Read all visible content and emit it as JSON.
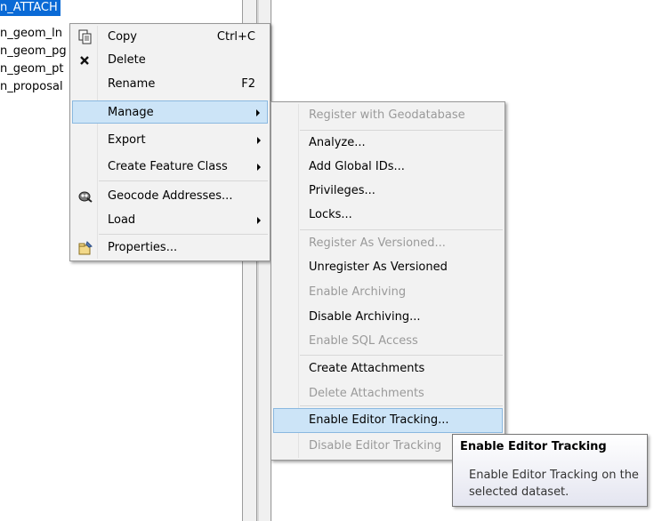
{
  "tree": {
    "items": [
      {
        "label": "n_ATTACH",
        "selected": true
      },
      {
        "label": "n_geom_ln",
        "selected": false
      },
      {
        "label": "n_geom_pg",
        "selected": false
      },
      {
        "label": "n_geom_pt",
        "selected": false
      },
      {
        "label": "n_proposal",
        "selected": false
      }
    ]
  },
  "context_menu": {
    "items": [
      {
        "label": "Copy",
        "shortcut": "Ctrl+C",
        "icon": "copy-icon"
      },
      {
        "label": "Delete",
        "icon": "delete-x-icon"
      },
      {
        "label": "Rename",
        "shortcut": "F2"
      },
      {
        "label": "Manage",
        "submenu": true,
        "highlighted": true
      },
      {
        "label": "Export",
        "submenu": true
      },
      {
        "label": "Create Feature Class",
        "submenu": true
      },
      {
        "label": "Geocode Addresses...",
        "icon": "geocode-icon"
      },
      {
        "label": "Load",
        "submenu": true
      },
      {
        "label": "Properties...",
        "icon": "properties-icon"
      }
    ]
  },
  "manage_submenu": {
    "items": [
      {
        "label": "Register with Geodatabase",
        "disabled": true
      },
      {
        "label": "Analyze...",
        "disabled": false
      },
      {
        "label": "Add Global IDs...",
        "disabled": false
      },
      {
        "label": "Privileges...",
        "disabled": false
      },
      {
        "label": "Locks...",
        "disabled": false
      },
      {
        "label": "Register As Versioned...",
        "disabled": true
      },
      {
        "label": "Unregister As Versioned",
        "disabled": false
      },
      {
        "label": "Enable Archiving",
        "disabled": true
      },
      {
        "label": "Disable Archiving...",
        "disabled": false
      },
      {
        "label": "Enable SQL Access",
        "disabled": true
      },
      {
        "label": "Create Attachments",
        "disabled": false
      },
      {
        "label": "Delete Attachments",
        "disabled": true
      },
      {
        "label": "Enable Editor Tracking...",
        "disabled": false,
        "highlighted": true
      },
      {
        "label": "Disable Editor Tracking",
        "disabled": true
      }
    ]
  },
  "tooltip": {
    "title": "Enable Editor Tracking",
    "body": "Enable Editor Tracking on the selected dataset."
  },
  "colors": {
    "selection": "#0a6ad6",
    "highlight": "#cce4f7",
    "disabled_text": "#9a9a9a"
  }
}
